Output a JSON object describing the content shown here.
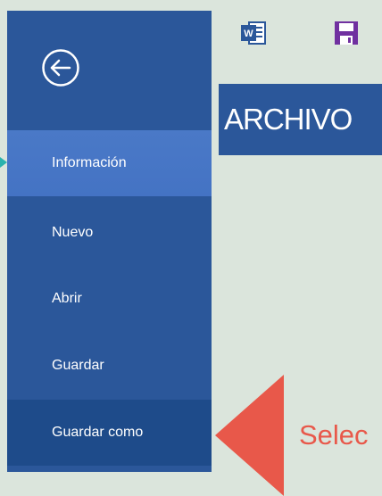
{
  "backstage": {
    "back_label": "",
    "items": [
      {
        "label": "Información"
      },
      {
        "label": "Nuevo"
      },
      {
        "label": "Abrir"
      },
      {
        "label": "Guardar"
      },
      {
        "label": "Guardar como"
      }
    ]
  },
  "ribbon": {
    "tab_label": "ARCHIVO",
    "icons": [
      "word-icon",
      "save-icon"
    ]
  },
  "annotation": {
    "text": "Selec"
  },
  "colors": {
    "backstage_bg": "#2b579a",
    "active_item_bg": "#4472c4",
    "selected_item_bg": "#1e4b8a",
    "annotation_red": "#e8584a",
    "pointer_teal": "#29b3ad",
    "save_icon_purple": "#7030a0",
    "page_bg": "#dbe5dc"
  }
}
